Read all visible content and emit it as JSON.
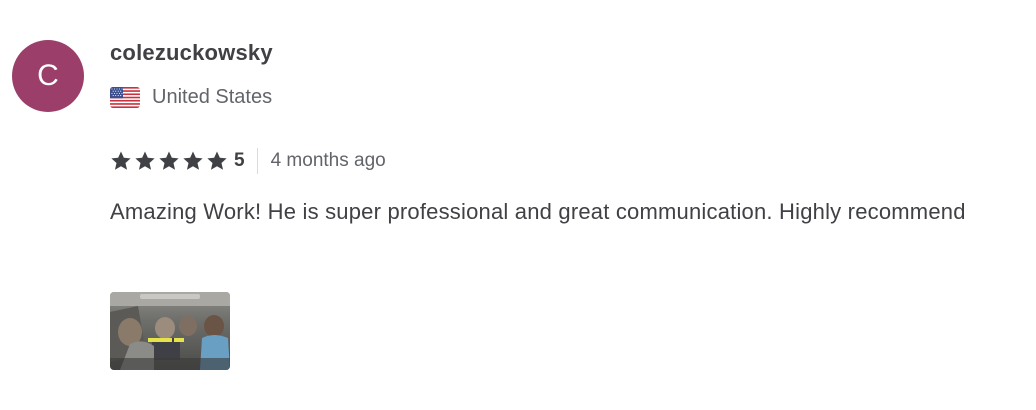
{
  "review": {
    "avatar_initial": "C",
    "username": "colezuckowsky",
    "country": "United States",
    "rating": "5",
    "stars_filled": 5,
    "stars_total": 5,
    "time_ago": "4 months ago",
    "comment": "Amazing Work! He is super professional and great communication. Highly recommend",
    "attachment": {
      "type": "video-thumbnail"
    }
  },
  "colors": {
    "avatar_bg": "#9b3f6a",
    "text_primary": "#404145",
    "text_secondary": "#62646a",
    "star": "#404145"
  },
  "icons": {
    "flag": "us-flag-icon",
    "star": "star-icon"
  }
}
